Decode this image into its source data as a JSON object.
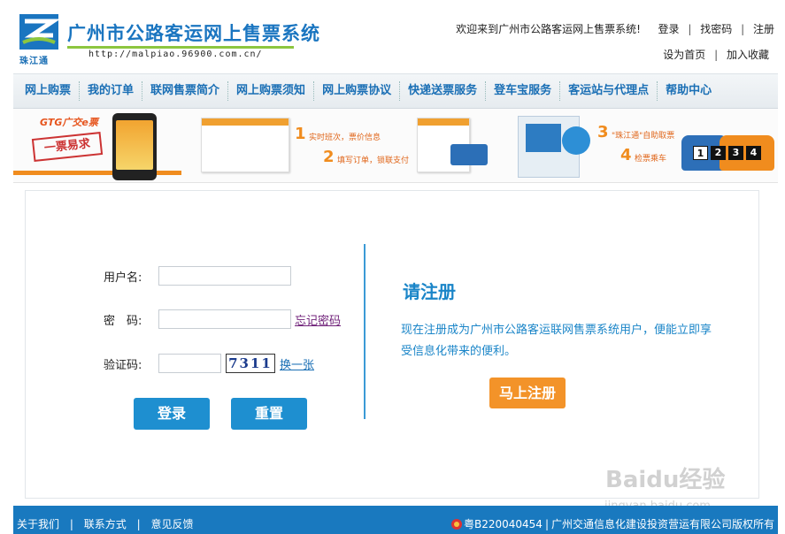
{
  "header": {
    "logo_caption": "珠江通",
    "site_title": "广州市公路客运网上售票系统",
    "site_url": "http://malpiao.96900.com.cn/",
    "welcome": "欢迎来到广州市公路客运网上售票系统!",
    "login": "登录",
    "find_password": "找密码",
    "register": "注册",
    "set_homepage": "设为首页",
    "add_favorite": "加入收藏"
  },
  "nav": {
    "items": [
      {
        "label": "网上购票"
      },
      {
        "label": "我的订单"
      },
      {
        "label": "联网售票简介"
      },
      {
        "label": "网上购票须知"
      },
      {
        "label": "网上购票协议"
      },
      {
        "label": "快递送票服务"
      },
      {
        "label": "登车宝服务"
      },
      {
        "label": "客运站与代理点"
      },
      {
        "label": "帮助中心"
      }
    ]
  },
  "banner": {
    "gtg": "GTG广交e票",
    "stamp": "一票易求",
    "steps": [
      {
        "num": "1",
        "text": "实时班次，票价信息"
      },
      {
        "num": "2",
        "text": "填写订单，锁联支付"
      },
      {
        "num": "3",
        "text": "\"珠江通\"自助取票"
      },
      {
        "num": "4",
        "text": "检票乘车"
      }
    ],
    "slides": [
      "1",
      "2",
      "3",
      "4"
    ]
  },
  "login_form": {
    "username_label": "用户名:",
    "username_value": "",
    "password_label": "密　码:",
    "password_value": "",
    "forgot_password": "忘记密码",
    "captcha_label": "验证码:",
    "captcha_value": "",
    "captcha_text": "7311",
    "change_captcha": "换一张",
    "login_button": "登录",
    "reset_button": "重置"
  },
  "register_panel": {
    "title": "请注册",
    "description": "现在注册成为广州市公路客运联网售票系统用户，便能立即享受信息化带来的便利。",
    "button": "马上注册"
  },
  "footer": {
    "about": "关于我们",
    "contact": "联系方式",
    "feedback": "意见反馈",
    "icp": "粤B220040454",
    "copyright": "广州交通信息化建设投资营运有限公司版权所有"
  },
  "watermark": {
    "brand": "Baidu经验",
    "url": "jingyan.baidu.com"
  },
  "colors": {
    "primary_blue": "#1a75c0",
    "button_blue": "#1e8fd0",
    "register_orange": "#f39329",
    "footer_blue": "#1979bf",
    "accent_green": "#8cc63f"
  }
}
